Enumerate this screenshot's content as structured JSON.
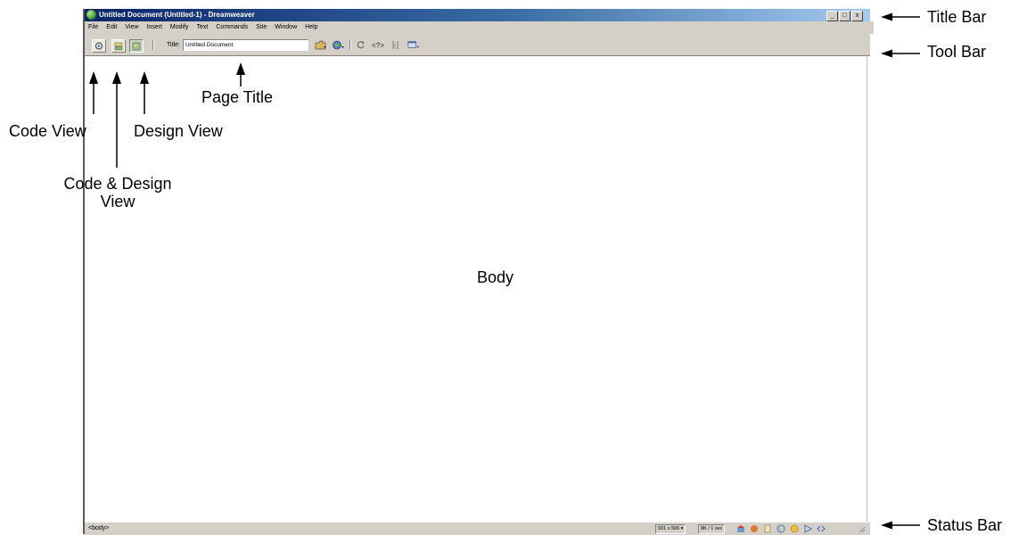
{
  "window": {
    "title": "Untitled Document (Untitled-1) - Dreamweaver",
    "buttons": {
      "minimize": "_",
      "maximize": "□",
      "close": "x"
    }
  },
  "menu": [
    "File",
    "Edit",
    "View",
    "Insert",
    "Modify",
    "Text",
    "Commands",
    "Site",
    "Window",
    "Help"
  ],
  "toolbar": {
    "title_label": "Title:",
    "title_value": "Untitled Document"
  },
  "statusbar": {
    "tag": "<body>",
    "window_size": "931 x 506 ▾",
    "download": "8K / 1 sec"
  },
  "annotations": {
    "title_bar": "Title Bar",
    "tool_bar": "Tool Bar",
    "status_bar": "Status Bar",
    "page_title": "Page Title",
    "code_view": "Code View",
    "design_view": "Design View",
    "code_design_line1": "Code & Design",
    "code_design_line2": "View",
    "body": "Body"
  },
  "colors": {
    "titlebar_start": "#0a246a",
    "titlebar_end": "#a6caf0",
    "chrome": "#d4d0c8"
  },
  "icons": [
    "dreamweaver-logo-icon",
    "code-view-icon",
    "split-view-icon",
    "design-view-icon",
    "file-management-icon",
    "preview-globe-icon",
    "refresh-icon",
    "reference-icon",
    "code-navigation-icon",
    "view-options-icon"
  ]
}
